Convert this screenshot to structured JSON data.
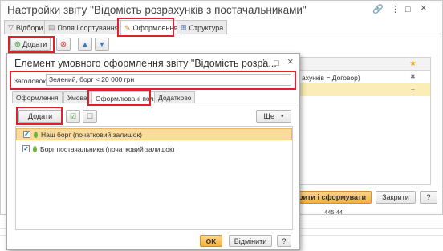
{
  "outer_window": {
    "title": "Настройки звіту \"Відомість розрахунків з постачальниками\"",
    "controls": {
      "link": "🔗",
      "more": "⋮",
      "maximize": "□",
      "close": "×"
    },
    "tabs": [
      {
        "label": "Відбори",
        "icon": "funnel-icon"
      },
      {
        "label": "Поля і сортування",
        "icon": "table-icon"
      },
      {
        "label": "Оформлення",
        "icon": "brush-icon"
      },
      {
        "label": "Структура",
        "icon": "structure-icon"
      }
    ],
    "toolbar": {
      "add_label": "Додати"
    },
    "grid": {
      "row1": "ахунків = Договор)",
      "col_x": "✖",
      "col_eq": "="
    },
    "star": "★",
    "buttons": {
      "close_and_generate": "Закрити і сформувати",
      "close": "Закрити",
      "more_partial": "?"
    }
  },
  "sheet": {
    "value": "445,44"
  },
  "dialog": {
    "title": "Елемент умовного оформлення звіту \"Відомість розра...",
    "controls": {
      "more": "⋮",
      "maximize": "□",
      "close": "×"
    },
    "header_label": "Заголовок:",
    "header_value": "Зелений, борг < 20 000 грн",
    "tabs": [
      "Оформлення",
      "Умова",
      "Оформлювані поля",
      "Додатково"
    ],
    "toolbar": {
      "add_label": "Додати",
      "more_label": "Ще",
      "more_arrow": "▾"
    },
    "fields": [
      {
        "label": "Наш борг (початковий залишок)",
        "checked": true
      },
      {
        "label": "Борг постачальника (початковий залишок)",
        "checked": true
      }
    ],
    "buttons": {
      "ok": "OK",
      "cancel": "Відмінити",
      "help": "?"
    },
    "colors": {
      "highlight": "#e0202a",
      "selection": "#fbdb9b",
      "ok": "#f4b13c"
    }
  }
}
